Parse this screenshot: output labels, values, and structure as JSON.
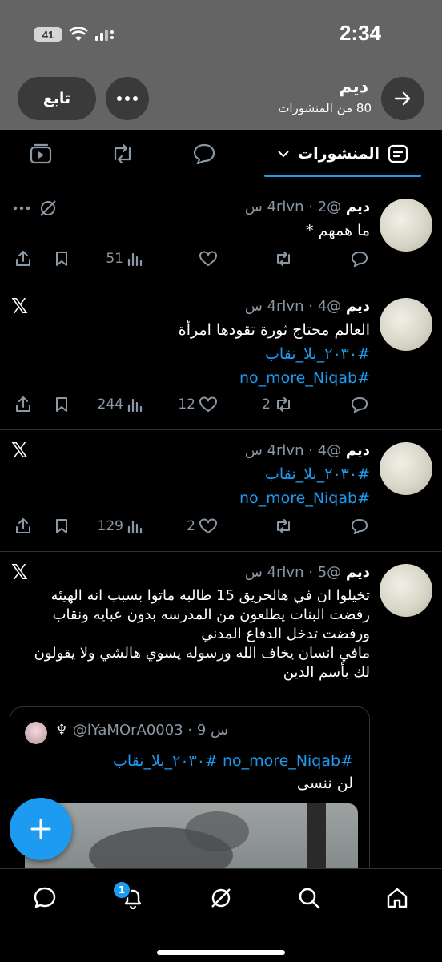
{
  "status_bar": {
    "time": "2:34",
    "battery": "41"
  },
  "header": {
    "follow_label": "تابع",
    "profile_name": "ديم",
    "post_count": "80 من المنشورات"
  },
  "tabs": {
    "posts_label": "المنشورات"
  },
  "posts": [
    {
      "name": "ديم",
      "handle": "@4rlvn",
      "time": "2 س",
      "lines": [
        "ما همهم *"
      ],
      "stats": {
        "views": "51",
        "likes": "",
        "reposts": "",
        "replies": ""
      }
    },
    {
      "name": "ديم",
      "handle": "@4rlvn",
      "time": "4 س",
      "lines": [
        "العالم محتاج ثورة تقودها امرأة"
      ],
      "hashtags": [
        "#٢٠٣٠_بلا_نقاب",
        "#no_more_Niqab"
      ],
      "stats": {
        "views": "244",
        "likes": "12",
        "reposts": "2",
        "replies": ""
      }
    },
    {
      "name": "ديم",
      "handle": "@4rlvn",
      "time": "4 س",
      "hashtags": [
        "#٢٠٣٠_بلا_نقاب",
        "#no_more_Niqab"
      ],
      "stats": {
        "views": "129",
        "likes": "2",
        "reposts": "",
        "replies": ""
      }
    },
    {
      "name": "ديم",
      "handle": "@4rlvn",
      "time": "5 س",
      "lines": [
        "تخيلوا ان في هالحريق 15 طالبه ماتوا بسبب انه الهيئه",
        "رفضت البنات يطلعون من المدرسه بدون عبايه ونقاب",
        "ورفضت تدخل الدفاع المدني",
        "مافي انسان يخاف الله ورسوله يسوي هالشي ولا يقولون",
        "لك بأسم الدين"
      ],
      "quote": {
        "handle": "@lYaMOrA0003",
        "symbol": "♆",
        "time": "9 س",
        "hashtags": "#no_more_Niqab #٢٠٣٠_بلا_نقاب",
        "text": "لن ننسى"
      }
    }
  ],
  "bottom_nav": {
    "notifications_badge": "1"
  },
  "colors": {
    "accent": "#1d9bf0",
    "header_bg": "#646464",
    "muted": "#8b98a5"
  }
}
